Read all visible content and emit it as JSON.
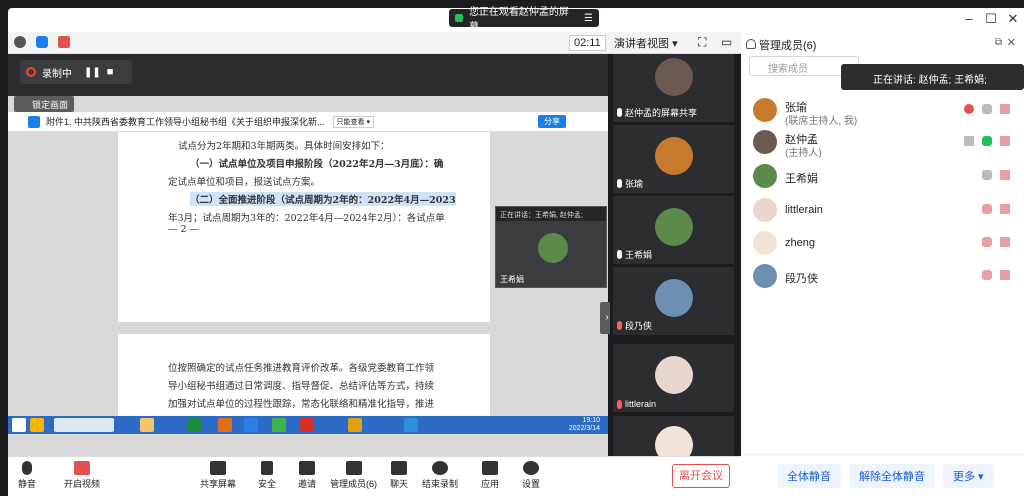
{
  "titlebar": {
    "share_status": "您正在观看赵仲孟的屏幕",
    "menu_icon": "hamburger-icon",
    "minimize": "–",
    "maximize": "☐",
    "close": "✕"
  },
  "toolbar": {
    "timer": "02:11",
    "view_label": "演讲者视图",
    "view_caret": "▾",
    "fullscreen": "⛶",
    "layout": "▭"
  },
  "recording": {
    "label": "录制中",
    "pause": "❚❚",
    "stop": "■"
  },
  "doc": {
    "lock_label": "锁定画面",
    "header_title": "附件1. 中共陕西省委教育工作领导小组秘书组《关于组织申报深化新...",
    "header_badge": "只能查看 ▾",
    "share_label": "分享",
    "page1": [
      "试点分为2年期和3年期两类。具体时间安排如下：",
      "（一）试点单位及项目申报阶段（2022年2月—3月底）：确",
      "定试点单位和项目，报送试点方案。",
      "（二）全面推进阶段（试点周期为2年的：2022年4月—2023",
      "年3月；试点周期为3年的：2022年4月—2024年2月）：各试点单",
      "— 2 —"
    ],
    "page2": [
      "位按照确定的试点任务推进教育评价改革。各级党委教育工作领",
      "导小组秘书组通过日常调度、指导督促、总结评估等方式，持续",
      "加强对试点单位的过程性跟踪，常态化联络和精准化指导，推进"
    ],
    "float_video_header": "正在讲话：王希娟, 赵仲孟;",
    "float_video_name": "王希娟",
    "taskbar_time": "19:10",
    "taskbar_date": "2022/3/14",
    "side_tab": "›"
  },
  "video_tiles": [
    {
      "name": "赵仲孟的屏幕共享",
      "color": "#6b5a52",
      "muted": false
    },
    {
      "name": "张瑜",
      "color": "#c77a2e",
      "muted": false
    },
    {
      "name": "王希娟",
      "color": "#5c8a4a",
      "muted": false
    },
    {
      "name": "段乃侠",
      "color": "#6d8fb0",
      "muted": true
    },
    {
      "name": "littlerain",
      "color": "#e9d6cf",
      "muted": true
    },
    {
      "name": "",
      "color": "#f1e3d8",
      "muted": true
    }
  ],
  "panel": {
    "title": "管理成员(6)",
    "search_placeholder": "搜索成员",
    "speaking": "正在讲话: 赵仲孟; 王希娟;",
    "members": [
      {
        "name": "张瑜",
        "role": "(联席主持人, 我)",
        "color": "#c77a2e"
      },
      {
        "name": "赵仲孟",
        "role": "(主持人)",
        "color": "#6b5a52"
      },
      {
        "name": "王希娟",
        "role": "",
        "color": "#5c8a4a"
      },
      {
        "name": "littlerain",
        "role": "",
        "color": "#e9d6cf"
      },
      {
        "name": "zheng",
        "role": "",
        "color": "#f1e3d8"
      },
      {
        "name": "段乃侠",
        "role": "",
        "color": "#6d8fb0"
      }
    ],
    "mute_all": "全体静音",
    "unmute_all": "解除全体静音",
    "more": "更多 ▾"
  },
  "bottombar": {
    "mute": "静音",
    "video": "开启视频",
    "share": "共享屏幕",
    "security": "安全",
    "invite": "邀请",
    "members": "管理成员(6)",
    "chat": "聊天",
    "record": "结束录制",
    "apps": "应用",
    "settings": "设置",
    "end": "离开会议"
  }
}
